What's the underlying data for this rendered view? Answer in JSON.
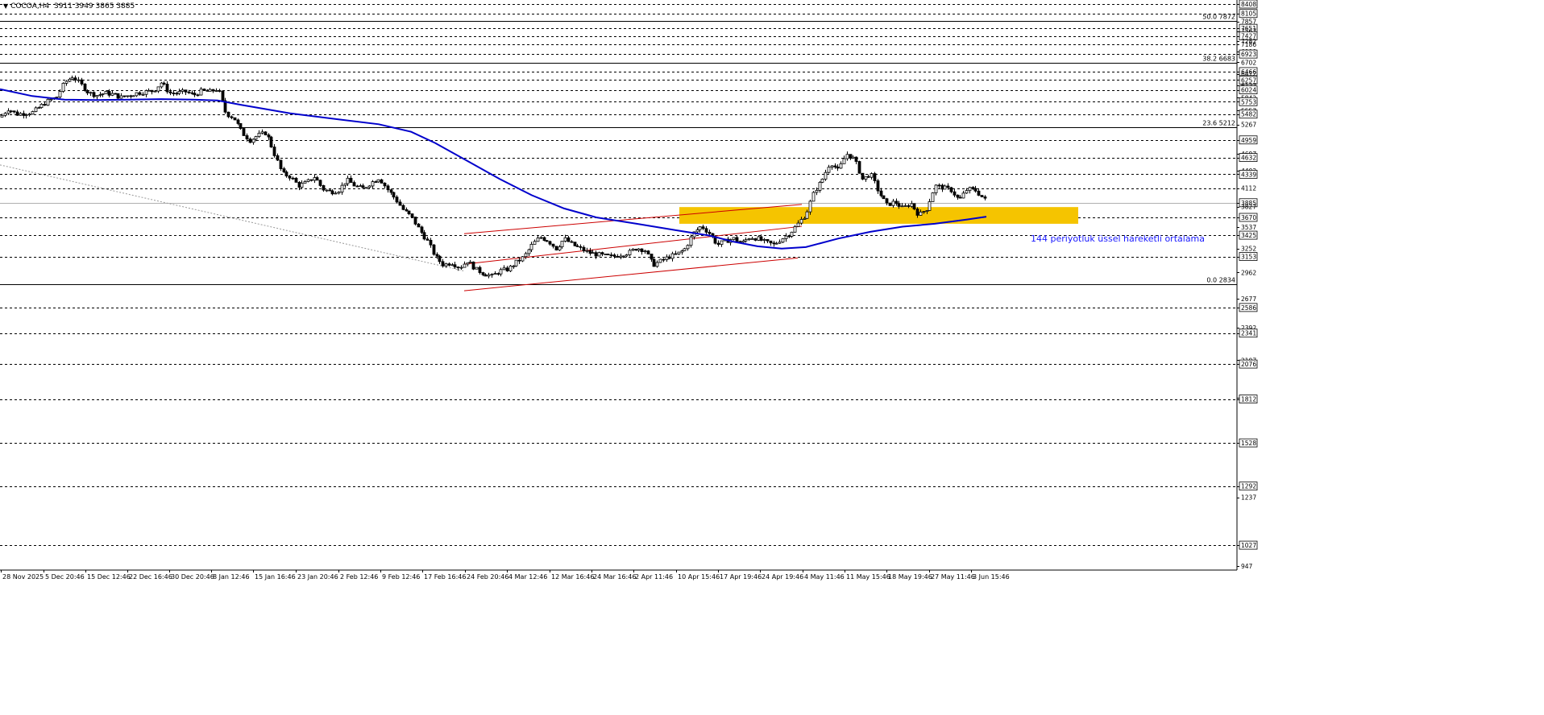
{
  "header": {
    "symbol": "COCOA,H4",
    "ohlc": "3911 3949 3865 3885"
  },
  "colors": {
    "background": "#ffffff",
    "grid": "#000000",
    "candle": "#000000",
    "ema": "#0000cc",
    "channel": "#cc0000",
    "zone": "#f5c400",
    "annotation": "#1a1aff"
  },
  "chart_data": {
    "type": "candlestick",
    "instrument": "COCOA",
    "timeframe": "H4",
    "ylim": [
      947,
      8408
    ],
    "price_labels": [
      "8408",
      "8105",
      "7857",
      "7651",
      "7567",
      "7427",
      "7282",
      "7186",
      "6990",
      "6923",
      "6702",
      "6466",
      "6412",
      "6257",
      "6127",
      "6024",
      "5842",
      "5753",
      "5557",
      "5482",
      "5267",
      "4959",
      "4697",
      "4632",
      "4402",
      "4339",
      "4112",
      "3885",
      "3827",
      "3670",
      "3537",
      "3425",
      "3252",
      "3153",
      "2962",
      "2677",
      "2586",
      "2392",
      "2341",
      "2107",
      "2076",
      "1822",
      "1812",
      "1528",
      "1292",
      "1237",
      "1027",
      "947"
    ],
    "boxed_levels": [
      8408,
      8105,
      7651,
      7427,
      6923,
      6466,
      6257,
      6024,
      5753,
      5482,
      4959,
      4632,
      4339,
      3885,
      3670,
      3425,
      3153,
      2586,
      2341,
      2076,
      1812,
      1528,
      1292,
      1027
    ],
    "dashed_levels": [
      8408,
      8105,
      7651,
      7427,
      7186,
      6923,
      6466,
      6257,
      6024,
      5753,
      5482,
      4959,
      4632,
      4339,
      4112,
      3670,
      3425,
      3153,
      2586,
      2341,
      2076,
      1812,
      1528,
      1292,
      1027
    ],
    "current_price": 3885,
    "fibonacci": [
      {
        "label": "50.0 7872",
        "value": 7872
      },
      {
        "label": "38.2 6683",
        "value": 6683
      },
      {
        "label": "23.6 5212",
        "value": 5212
      },
      {
        "label": "0.0 2834",
        "value": 2834
      }
    ],
    "x_labels": [
      "28 Nov 2025",
      "5 Dec 20:46",
      "15 Dec 12:46",
      "22 Dec 16:46",
      "30 Dec 20:46",
      "8 Jan 12:46",
      "15 Jan 16:46",
      "23 Jan 20:46",
      "2 Feb 12:46",
      "9 Feb 12:46",
      "17 Feb 16:46",
      "24 Feb 20:46",
      "4 Mar 12:46",
      "12 Mar 16:46",
      "24 Mar 16:46",
      "2 Apr 11:46",
      "10 Apr 15:46",
      "17 Apr 19:46",
      "24 Apr 19:46",
      "4 May 11:46",
      "11 May 15:46",
      "18 May 19:46",
      "27 May 11:46",
      "3 Jun 15:46"
    ],
    "price_path": [
      [
        0,
        5420
      ],
      [
        10,
        5600
      ],
      [
        20,
        5480
      ],
      [
        30,
        5500
      ],
      [
        40,
        5520
      ],
      [
        50,
        5650
      ],
      [
        60,
        5780
      ],
      [
        70,
        5850
      ],
      [
        80,
        6200
      ],
      [
        90,
        6350
      ],
      [
        100,
        6150
      ],
      [
        110,
        5950
      ],
      [
        120,
        5900
      ],
      [
        130,
        5950
      ],
      [
        140,
        5920
      ],
      [
        150,
        5850
      ],
      [
        160,
        5900
      ],
      [
        170,
        5950
      ],
      [
        180,
        5980
      ],
      [
        190,
        6000
      ],
      [
        200,
        6200
      ],
      [
        210,
        5950
      ],
      [
        220,
        5950
      ],
      [
        230,
        5980
      ],
      [
        240,
        5900
      ],
      [
        250,
        6000
      ],
      [
        260,
        5980
      ],
      [
        270,
        6050
      ],
      [
        280,
        5500
      ],
      [
        290,
        5400
      ],
      [
        300,
        5100
      ],
      [
        310,
        4950
      ],
      [
        320,
        5050
      ],
      [
        330,
        5100
      ],
      [
        340,
        4700
      ],
      [
        350,
        4350
      ],
      [
        360,
        4300
      ],
      [
        370,
        4150
      ],
      [
        380,
        4200
      ],
      [
        390,
        4300
      ],
      [
        400,
        4100
      ],
      [
        410,
        4050
      ],
      [
        420,
        4080
      ],
      [
        430,
        4250
      ],
      [
        440,
        4150
      ],
      [
        450,
        4100
      ],
      [
        460,
        4200
      ],
      [
        470,
        4280
      ],
      [
        480,
        4100
      ],
      [
        490,
        3950
      ],
      [
        500,
        3780
      ],
      [
        510,
        3680
      ],
      [
        520,
        3500
      ],
      [
        530,
        3350
      ],
      [
        540,
        3150
      ],
      [
        550,
        3050
      ],
      [
        560,
        3080
      ],
      [
        570,
        3020
      ],
      [
        580,
        3100
      ],
      [
        590,
        3000
      ],
      [
        600,
        2950
      ],
      [
        610,
        2920
      ],
      [
        620,
        2980
      ],
      [
        630,
        3000
      ],
      [
        640,
        3080
      ],
      [
        650,
        3150
      ],
      [
        660,
        3300
      ],
      [
        670,
        3400
      ],
      [
        680,
        3350
      ],
      [
        690,
        3250
      ],
      [
        700,
        3380
      ],
      [
        710,
        3300
      ],
      [
        720,
        3250
      ],
      [
        730,
        3200
      ],
      [
        740,
        3180
      ],
      [
        750,
        3160
      ],
      [
        760,
        3150
      ],
      [
        770,
        3180
      ],
      [
        780,
        3200
      ],
      [
        790,
        3260
      ],
      [
        800,
        3230
      ],
      [
        810,
        3050
      ],
      [
        820,
        3100
      ],
      [
        830,
        3150
      ],
      [
        840,
        3180
      ],
      [
        850,
        3250
      ],
      [
        860,
        3450
      ],
      [
        870,
        3550
      ],
      [
        880,
        3450
      ],
      [
        890,
        3300
      ],
      [
        900,
        3350
      ],
      [
        910,
        3380
      ],
      [
        920,
        3320
      ],
      [
        930,
        3400
      ],
      [
        940,
        3380
      ],
      [
        950,
        3330
      ],
      [
        960,
        3300
      ],
      [
        970,
        3380
      ],
      [
        980,
        3450
      ],
      [
        990,
        3580
      ],
      [
        1000,
        3720
      ],
      [
        1010,
        4050
      ],
      [
        1020,
        4250
      ],
      [
        1030,
        4550
      ],
      [
        1040,
        4400
      ],
      [
        1050,
        4700
      ],
      [
        1060,
        4600
      ],
      [
        1070,
        4250
      ],
      [
        1080,
        4350
      ],
      [
        1090,
        4050
      ],
      [
        1100,
        3850
      ],
      [
        1110,
        3900
      ],
      [
        1120,
        3800
      ],
      [
        1130,
        3880
      ],
      [
        1140,
        3700
      ],
      [
        1150,
        3800
      ],
      [
        1160,
        4150
      ],
      [
        1170,
        4120
      ],
      [
        1180,
        4080
      ],
      [
        1190,
        3920
      ],
      [
        1200,
        4100
      ],
      [
        1210,
        4080
      ],
      [
        1220,
        3950
      ],
      [
        1226,
        3885
      ]
    ],
    "ema": {
      "name": "144 periyotluk üssel hareketli ortalama",
      "points": [
        [
          0,
          6040
        ],
        [
          40,
          5880
        ],
        [
          80,
          5800
        ],
        [
          120,
          5790
        ],
        [
          160,
          5800
        ],
        [
          200,
          5810
        ],
        [
          240,
          5800
        ],
        [
          270,
          5780
        ],
        [
          300,
          5680
        ],
        [
          360,
          5500
        ],
        [
          420,
          5370
        ],
        [
          470,
          5270
        ],
        [
          510,
          5120
        ],
        [
          540,
          4900
        ],
        [
          580,
          4570
        ],
        [
          620,
          4260
        ],
        [
          660,
          4000
        ],
        [
          700,
          3800
        ],
        [
          740,
          3670
        ],
        [
          790,
          3580
        ],
        [
          840,
          3490
        ],
        [
          880,
          3420
        ],
        [
          910,
          3340
        ],
        [
          940,
          3280
        ],
        [
          970,
          3250
        ],
        [
          1000,
          3270
        ],
        [
          1040,
          3380
        ],
        [
          1080,
          3470
        ],
        [
          1120,
          3540
        ],
        [
          1160,
          3580
        ],
        [
          1200,
          3640
        ],
        [
          1224,
          3680
        ]
      ]
    },
    "channel": [
      {
        "from": [
          576,
          3445
        ],
        "to": [
          995,
          3860
        ]
      },
      {
        "from": [
          576,
          3060
        ],
        "to": [
          995,
          3545
        ]
      },
      {
        "from": [
          576,
          2760
        ],
        "to": [
          990,
          3135
        ]
      }
    ],
    "dotted_trend": {
      "from": [
        0,
        4500
      ],
      "to": [
        576,
        2980
      ]
    },
    "zone": {
      "x_from": 843,
      "x_to": 1338,
      "y_from": 3580,
      "y_to": 3820
    },
    "annotation": "144 periyotluk üssel hareketli ortalama"
  }
}
